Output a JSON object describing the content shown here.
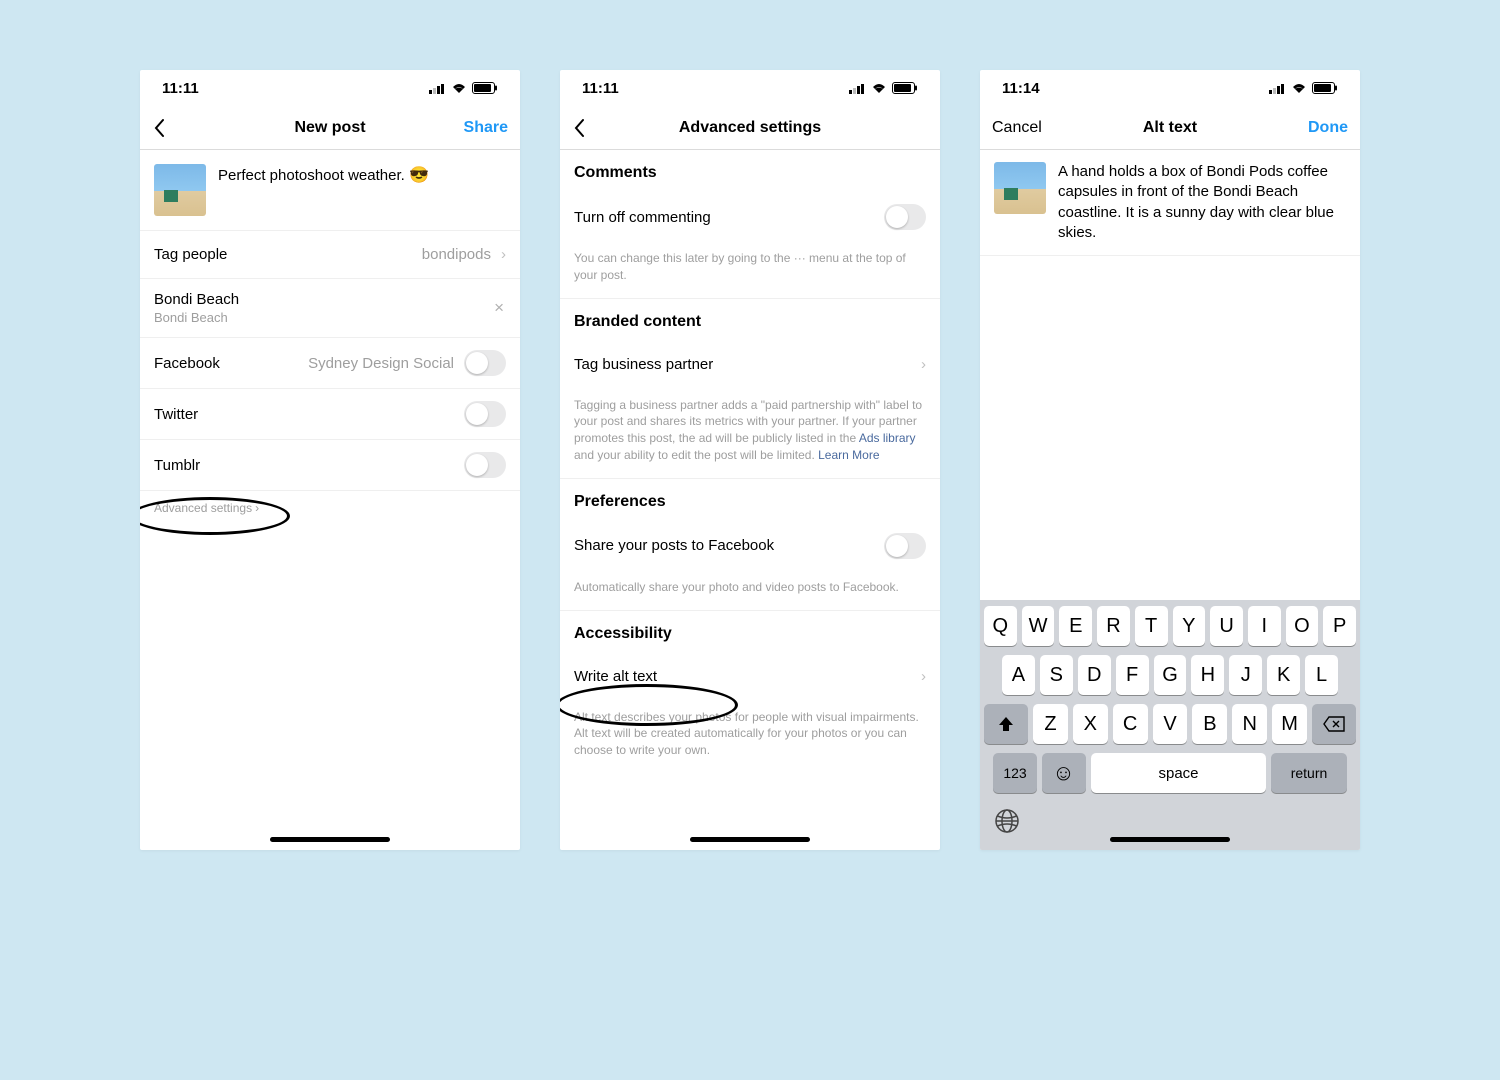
{
  "status": {
    "time1": "11:11",
    "time2": "11:11",
    "time3": "11:14"
  },
  "screen1": {
    "title": "New post",
    "share": "Share",
    "caption": "Perfect photoshoot weather. ",
    "tagPeople": {
      "label": "Tag people",
      "value": "bondipods"
    },
    "location": {
      "name": "Bondi Beach",
      "sub": "Bondi Beach"
    },
    "facebook": {
      "label": "Facebook",
      "value": "Sydney Design Social"
    },
    "twitter": "Twitter",
    "tumblr": "Tumblr",
    "advanced": "Advanced settings"
  },
  "screen2": {
    "title": "Advanced settings",
    "comments": {
      "header": "Comments",
      "toggleLabel": "Turn off commenting",
      "sub": "You can change this later by going to the ··· menu at the top of your post."
    },
    "branded": {
      "header": "Branded content",
      "row": "Tag business partner",
      "sub1": "Tagging a business partner adds a \"paid partnership with\" label to your post and shares its metrics with your partner. If your partner promotes this post, the ad will be publicly listed in the ",
      "adsLibrary": "Ads library",
      "sub2": " and your ability to edit the post will be limited. ",
      "learnMore": "Learn More"
    },
    "prefs": {
      "header": "Preferences",
      "row": "Share your posts to Facebook",
      "sub": "Automatically share your photo and video posts to Facebook."
    },
    "a11y": {
      "header": "Accessibility",
      "row": "Write alt text",
      "sub": "Alt text describes your photos for people with visual impairments. Alt text will be created automatically for your photos or you can choose to write your own."
    }
  },
  "screen3": {
    "cancel": "Cancel",
    "title": "Alt text",
    "done": "Done",
    "altText": "A hand holds a box of Bondi Pods coffee capsules in front of the Bondi Beach coastline. It is a sunny day with clear blue skies."
  },
  "keyboard": {
    "row1": [
      "Q",
      "W",
      "E",
      "R",
      "T",
      "Y",
      "U",
      "I",
      "O",
      "P"
    ],
    "row2": [
      "A",
      "S",
      "D",
      "F",
      "G",
      "H",
      "J",
      "K",
      "L"
    ],
    "row3": [
      "Z",
      "X",
      "C",
      "V",
      "B",
      "N",
      "M"
    ],
    "numKey": "123",
    "space": "space",
    "return": "return"
  }
}
